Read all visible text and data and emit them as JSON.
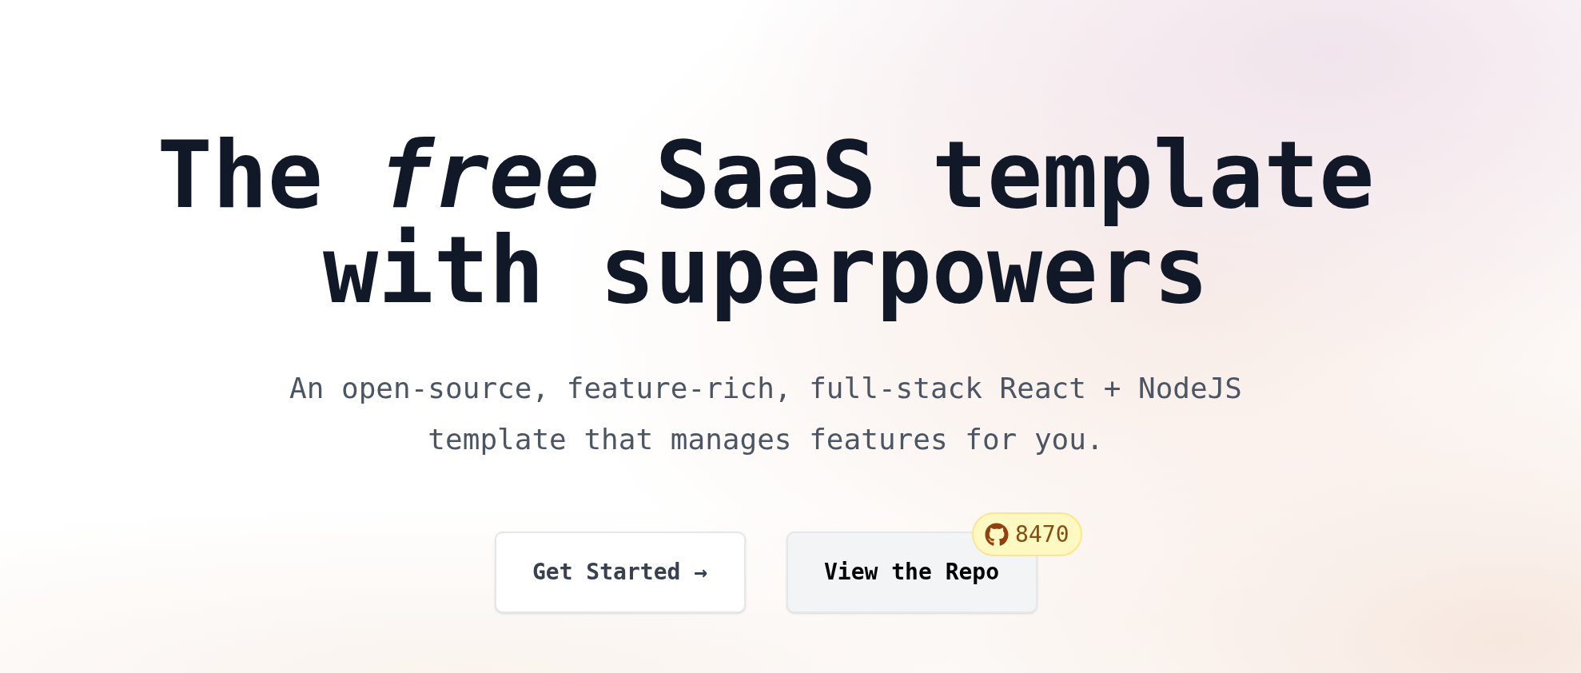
{
  "hero": {
    "heading": "The *free* SaaS template with superpowers",
    "subtitle": "An open-source, feature-rich, full-stack React + NodeJS template that manages features for you.",
    "buttons": [
      {
        "label": "Get Started →",
        "kind": "outline"
      },
      {
        "label": "View the Repo",
        "kind": "filled",
        "badge": "8470"
      }
    ]
  }
}
